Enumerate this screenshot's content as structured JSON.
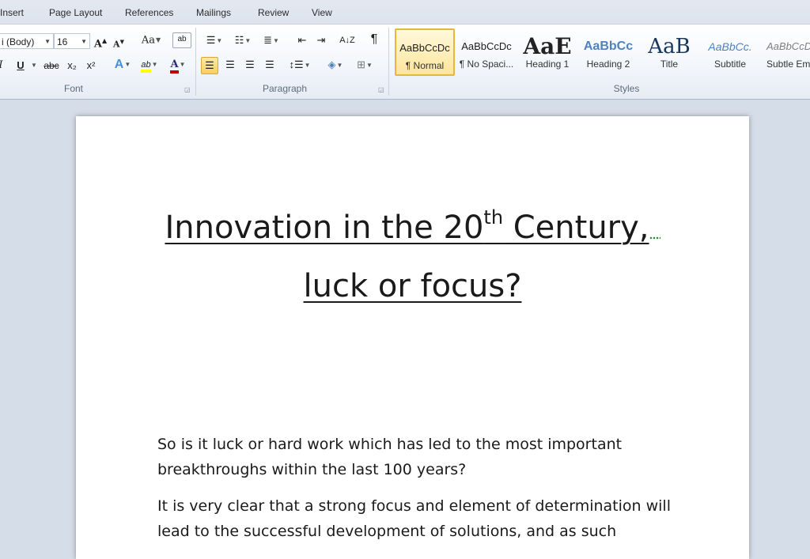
{
  "tabs": [
    "Insert",
    "Page Layout",
    "References",
    "Mailings",
    "Review",
    "View"
  ],
  "font": {
    "name": "i (Body)",
    "size": "16",
    "group_label": "Font",
    "grow_label": "A",
    "shrink_label": "A",
    "change_case_label": "Aa",
    "italic_label": "I",
    "underline_label": "U",
    "strike_label": "abc",
    "subscript_label": "x₂",
    "superscript_label": "x²",
    "effects_label": "A",
    "highlight_label": "ab",
    "color_label": "A",
    "highlight_color": "#ffff00",
    "font_color": "#c00000"
  },
  "paragraph": {
    "group_label": "Paragraph",
    "pilcrow_label": "¶",
    "sort_label": "A↓Z"
  },
  "styles": {
    "group_label": "Styles",
    "items": [
      {
        "sample": "AaBbCcDc",
        "name": "¶ Normal"
      },
      {
        "sample": "AaBbCcDc",
        "name": "¶ No Spaci..."
      },
      {
        "sample": "AaE",
        "name": "Heading 1"
      },
      {
        "sample": "AaBbCc",
        "name": "Heading 2"
      },
      {
        "sample": "AaB",
        "name": "Title"
      },
      {
        "sample": "AaBbCc.",
        "name": "Subtitle"
      },
      {
        "sample": "AaBbCcDc",
        "name": "Subtle Em"
      }
    ]
  },
  "document": {
    "title_line1_a": "Innovation in the 20",
    "title_sup": "th",
    "title_line1_b": " Century,",
    "title_line2": "luck or focus?",
    "para1_line1": "So is it luck or hard work which has led to the most important",
    "para1_line2": "breakthroughs within the last 100 years?",
    "para2_line1": "It is very clear that a strong focus and element of determination will",
    "para2_line2": "lead to the successful development of solutions, and as such"
  }
}
